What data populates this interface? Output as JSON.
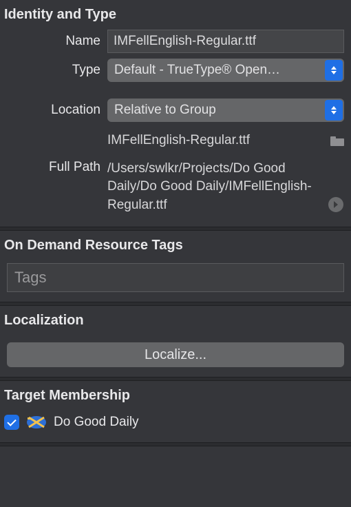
{
  "identity": {
    "header": "Identity and Type",
    "name_label": "Name",
    "name_value": "IMFellEnglish-Regular.ttf",
    "type_label": "Type",
    "type_value": "Default - TrueType® Open…",
    "location_label": "Location",
    "location_value": "Relative to Group",
    "filename_value": "IMFellEnglish-Regular.ttf",
    "fullpath_label": "Full Path",
    "fullpath_value": "/Users/swlkr/Projects/Do Good Daily/Do Good Daily/IMFellEnglish-Regular.ttf"
  },
  "odr": {
    "header": "On Demand Resource Tags",
    "tags_placeholder": "Tags"
  },
  "localization": {
    "header": "Localization",
    "button": "Localize..."
  },
  "target": {
    "header": "Target Membership",
    "checked": true,
    "app_name": "Do Good Daily"
  }
}
